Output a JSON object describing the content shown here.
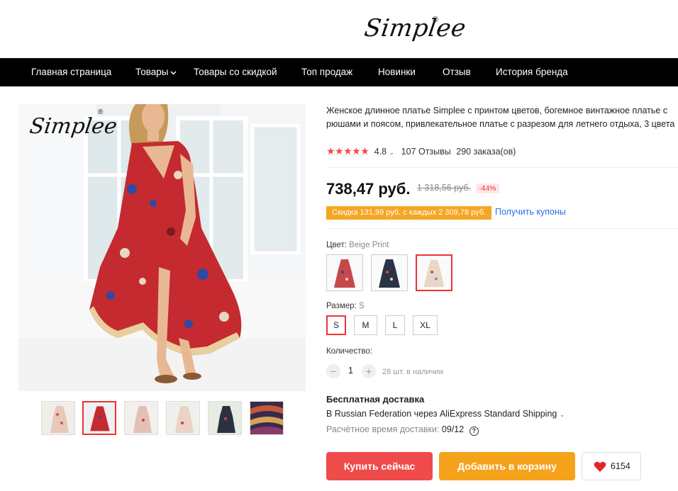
{
  "header": {
    "logo": "Simplee",
    "logo_mark": "®"
  },
  "nav": {
    "items": [
      {
        "label": "Главная страница"
      },
      {
        "label": "Товары"
      },
      {
        "label": "Товары со скидкой"
      },
      {
        "label": "Топ продаж"
      },
      {
        "label": "Новинки"
      },
      {
        "label": "Отзыв"
      },
      {
        "label": "История бренда"
      }
    ]
  },
  "gallery": {
    "watermark": "Simplee",
    "watermark_mark": "®",
    "selected_thumb": 2,
    "thumb_count": 6
  },
  "product": {
    "title": "Женское длинное платье Simplee с принтом цветов, богемное винтажное платье с рюшами и поясом, привлекательное платье с разрезом для летнего отдыха, 3 цвета",
    "rating": "4.8",
    "stars": "★★★★★",
    "reviews": "107 Отзывы",
    "orders": "290 заказа(ов)",
    "price": "738,47 руб.",
    "old_price": "1 318,56 руб.",
    "discount": "-44%",
    "coupon": "Скидка 131,99 руб. с каждых 2 309,78 руб.",
    "coupon_link": "Получить купоны",
    "color_label": "Цвет:",
    "color_value": "Beige Print",
    "size_label": "Размер:",
    "size_value": "S",
    "sizes": [
      "S",
      "M",
      "L",
      "XL"
    ],
    "selected_size": "S",
    "qty_label": "Количество:",
    "qty": "1",
    "qty_minus": "−",
    "qty_plus": "+",
    "stock": "28 шт. в наличии"
  },
  "shipping": {
    "title": "Бесплатная доставка",
    "line": "В Russian Federation через AliExpress Standard Shipping",
    "eta_label": "Расчётное время доставки:",
    "eta_date": "09/12",
    "help": "?"
  },
  "actions": {
    "buy": "Купить сейчас",
    "cart": "Добавить в корзину",
    "wishlist_count": "6154"
  },
  "colors": {
    "accent_red": "#f04b4b",
    "accent_orange": "#f5a21b",
    "coupon_bg": "#f5a623",
    "link_blue": "#2a6ee8",
    "nav_bg": "#000000"
  }
}
